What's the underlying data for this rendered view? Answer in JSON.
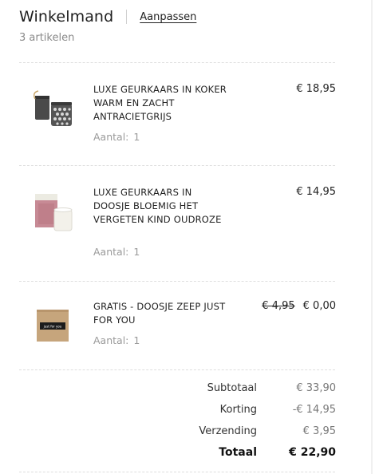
{
  "cart": {
    "title": "Winkelmand",
    "edit_label": "Aanpassen",
    "item_count": "3 artikelen"
  },
  "qty_label": "Aantal:",
  "items": [
    {
      "name": "LUXE GEURKAARS IN KOKER WARM EN ZACHT ANTRACIETGRIJS",
      "qty": "1",
      "price": "€ 18,95",
      "image_icon": "candle-tin-icon"
    },
    {
      "name": "LUXE GEURKAARS IN DOOSJE BLOEMIG HET VERGETEN KIND OUDROZE",
      "qty": "1",
      "price": "€ 14,95",
      "image_icon": "candle-box-icon"
    },
    {
      "name": "GRATIS - DOOSJE ZEEP JUST FOR YOU",
      "qty": "1",
      "old_price": "€ 4,95",
      "price": "€ 0,00",
      "image_icon": "soap-box-icon",
      "image_text": "just for you"
    }
  ],
  "totals": {
    "subtotal_label": "Subtotaal",
    "subtotal": "€ 33,90",
    "discount_label": "Korting",
    "discount": "-€ 14,95",
    "shipping_label": "Verzending",
    "shipping": "€ 3,95",
    "total_label": "Totaal",
    "total": "€ 22,90"
  }
}
